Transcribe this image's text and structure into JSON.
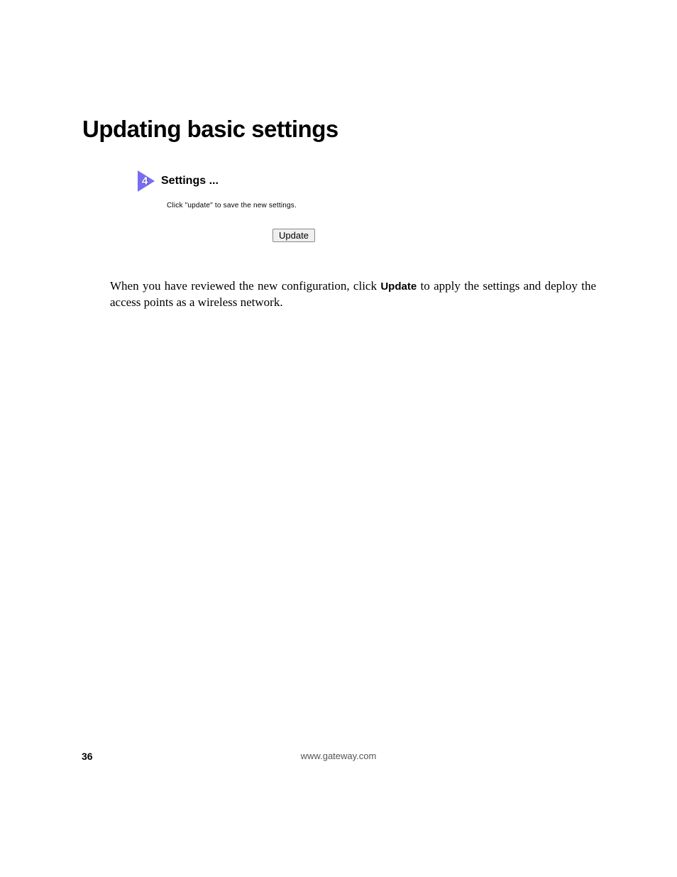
{
  "heading": "Updating basic settings",
  "panel": {
    "step_number": "4",
    "title": "Settings ...",
    "instruction": "Click \"update\" to save the new settings.",
    "button_label": "Update"
  },
  "body": {
    "part1": "When you have reviewed the new configuration, click ",
    "bold": "Update",
    "part2": " to apply the settings and deploy the access points as a wireless network."
  },
  "footer": {
    "page_number": "36",
    "url": "www.gateway.com"
  }
}
